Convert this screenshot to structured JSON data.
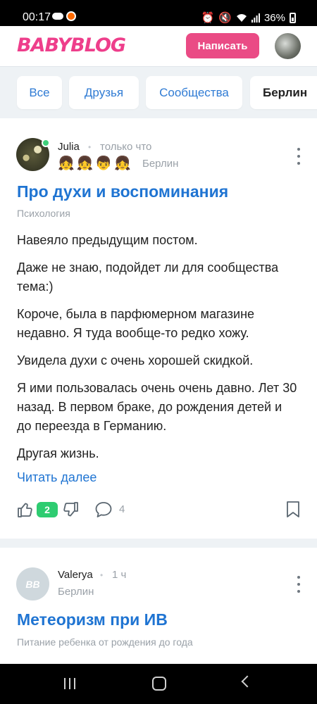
{
  "status_bar": {
    "time": "00:17",
    "battery": "36%"
  },
  "header": {
    "logo": "BABYBLOG",
    "write_button": "Написать"
  },
  "filters": [
    {
      "label": "Все"
    },
    {
      "label": "Друзья"
    },
    {
      "label": "Сообщества"
    },
    {
      "label": "Берлин"
    }
  ],
  "posts": [
    {
      "author": "Julia",
      "time": "только что",
      "emojis": [
        "👧",
        "👧",
        "👦",
        "👧"
      ],
      "city": "Берлин",
      "title": "Про духи и воспоминания",
      "category": "Психология",
      "paragraphs": [
        "Навеяло предыдущим постом.",
        "Даже не знаю, подойдет ли для сообщества тема:)",
        "Короче, была в парфюмерном магазине недавно. Я туда вообще-то редко хожу.",
        "Увидела духи с очень хорошей скидкой.",
        "Я ими пользовалась очень очень давно. Лет 30 назад. В первом браке, до рождения детей и до переезда в Германию.",
        "Другая жизнь."
      ],
      "read_more": "Читать далее",
      "likes": "2",
      "comments": "4"
    },
    {
      "author": "Valerya",
      "avatar_initials": "BB",
      "time": "1 ч",
      "city": "Берлин",
      "title": "Метеоризм при ИВ",
      "category": "Питание ребенка от рождения до года"
    }
  ]
}
